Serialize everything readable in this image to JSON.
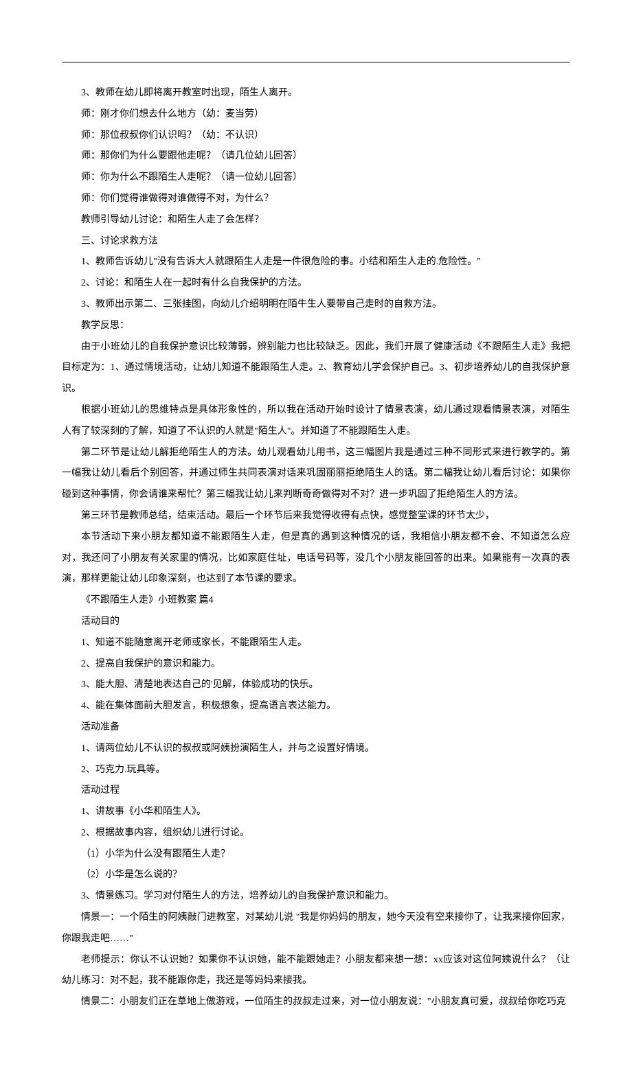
{
  "lines": [
    "3、教师在幼儿即将离开教室时出现，陌生人离开。",
    "师：刚才你们想去什么地方（幼：麦当劳）",
    "师：那位叔叔你们认识吗？（幼：不认识）",
    "师：那你们为什么要跟他走呢？（请几位幼儿回答）",
    "师：你为什么不跟陌生人走呢？（请一位幼儿回答）",
    "师：你们觉得谁做得对谁做得不对，为什么？",
    "教师引导幼儿讨论：和陌生人走了会怎样？",
    "三、讨论求救方法",
    "1、教师告诉幼儿\"没有告诉大人就跟陌生人走是一件很危险的事。小结和陌生人走的.危险性。\"",
    "2、讨论：和陌生人在一起时有什么自我保护的方法。",
    "3、教师出示第二、三张挂图，向幼儿介绍明明在陌牛生人要带自己走时的自救方法。",
    "教学反思：",
    "由于小班幼儿的自我保护意识比较薄弱，辨别能力也比较缺乏。因此，我们开展了健康活动《不跟陌生人走》我把目标定为：1、通过情境活动，让幼儿知道不能跟陌生人走。2、教育幼儿学会保护自己。3、初步培养幼儿的自我保护意识。",
    "根据小班幼儿的思维特点是具体形象性的，所以我在活动开始时设计了情景表演，幼儿通过观看情景表演，对陌生人有了较深刻的了解，知道了不认识的人就是\"陌生人\"。并知道了不能跟陌生人走。",
    "第二环节是让幼儿解拒绝陌生人的方法。幼儿观看幼儿用书，这三幅图片我是通过三种不同形式来进行教学的。第一幅我让幼儿看后个别回答，并通过师生共同表演对话来巩固丽丽拒绝陌生人的话。第二幅我让幼儿看后讨论：如果你碰到这种事情，你会请谁来帮忙？第三幅我让幼儿来判断奇奇做得对不对？进一步巩固了拒绝陌生人的方法。",
    "第三环节是教师总结，结束活动。最后一个环节后来我觉得收得有点快，感觉整堂课的环节太少，",
    "本节活动下来小朋友都知道不能跟陌生人走，但是真的遇到这种情况的话，我相信小朋友都不会、不知道怎么应对，我还问了小朋友有关家里的情况，比如家庭住址，电话号码等，没几个小朋友能回答的出来。如果能有一次真的表演，那样更能让幼儿印象深刻，也达到了本节课的要求。",
    "《不跟陌生人走》小班教案 篇4",
    "活动目的",
    "1、知道不能随意离开老师或家长，不能跟陌生人走。",
    "2、提高自我保护的意识和能力。",
    "3、能大胆、清楚地表达自己的'见解，体验成功的快乐。",
    "4、能在集体面前大胆发言，积极想象，提高语言表达能力。",
    "活动准备",
    "1、请两位幼儿不认识的叔叔或阿姨扮演陌生人，并与之设置好情境。",
    "2、巧克力.玩具等。",
    "活动过程",
    "1、讲故事《小华和陌生人》。",
    "2、根据故事内容，组织幼儿进行讨论。",
    "（1）小华为什么没有跟陌生人走？",
    "（2）小华是怎么说的？",
    "3、情景练习。学习对付陌生人的方法，培养幼儿的自我保护意识和能力。",
    "情景一：一个陌生的阿姨敲门进教室，对某幼儿说 \"我是你妈妈的朋友，她今天没有空来接你了，让我来接你回家，你跟我走吧……\"",
    "老师提示：你认不认识她？如果你不认识她，能不能跟她走？小朋友都来想一想：xx应该对这位阿姨说什么？（让幼儿练习：对不起，我不能跟你走，我还是等妈妈来接我。",
    "情景二：小朋友们正在草地上做游戏，一位陌生的叔叔走过来，对一位小朋友说：\"小朋友真可爱，叔叔给你吃巧克"
  ]
}
